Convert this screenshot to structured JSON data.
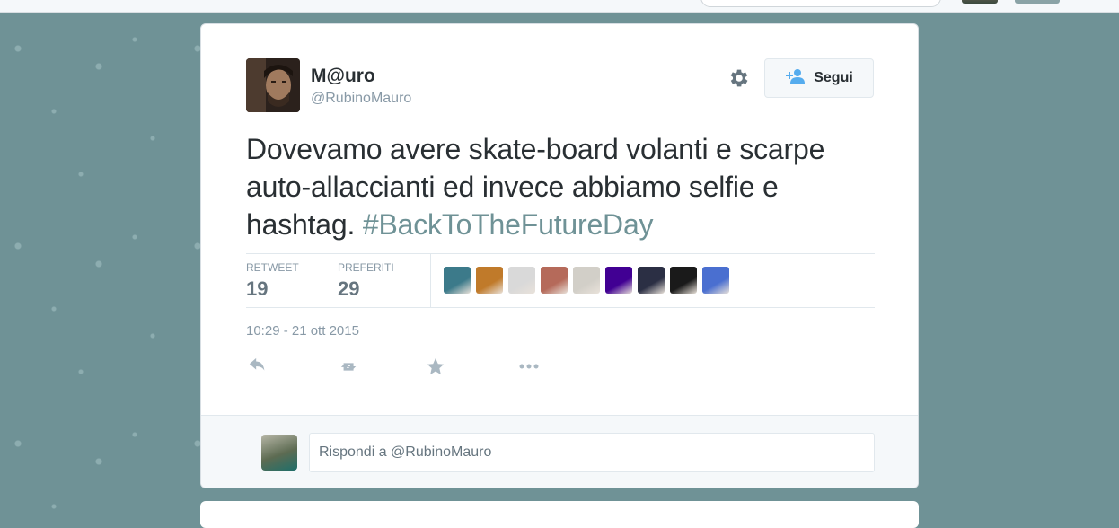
{
  "tweet": {
    "author": {
      "display_name": "M@uro",
      "screen_name": "@RubinoMauro",
      "avatar_icon": "user-avatar"
    },
    "follow_label": "Segui",
    "text_main": "Dovevamo avere skate-board volanti e scarpe auto-allaccianti ed invece abbiamo selfie e hashtag.",
    "hashtag": "#BackToTheFutureDay",
    "stats": {
      "retweet_label": "RETWEET",
      "retweet_count": "19",
      "favorites_label": "PREFERITI",
      "favorites_count": "29"
    },
    "favoriters": [
      {
        "name": "favoriter-1",
        "color": "#3c7a8a"
      },
      {
        "name": "favoriter-2",
        "color": "#c07a2a"
      },
      {
        "name": "favoriter-3",
        "color": "#d9d9d9"
      },
      {
        "name": "favoriter-4",
        "color": "#b56a5a"
      },
      {
        "name": "favoriter-5",
        "color": "#d2cfc8"
      },
      {
        "name": "favoriter-6",
        "color": "#410093"
      },
      {
        "name": "favoriter-7",
        "color": "#2b2f44"
      },
      {
        "name": "favoriter-8",
        "color": "#1a1a1a"
      },
      {
        "name": "favoriter-9",
        "color": "#4a6fd0"
      }
    ],
    "timestamp": "10:29 - 21 ott 2015"
  },
  "reply": {
    "placeholder": "Rispondi a @RubinoMauro"
  },
  "colors": {
    "background": "#6f9296",
    "accent": "#6f9296",
    "text_primary": "#292f33",
    "text_muted": "#8899a6"
  },
  "icons": {
    "follow": "add-user-icon",
    "settings": "gear-icon",
    "reply": "reply-icon",
    "retweet": "retweet-icon",
    "favorite": "star-icon",
    "more": "more-icon"
  }
}
